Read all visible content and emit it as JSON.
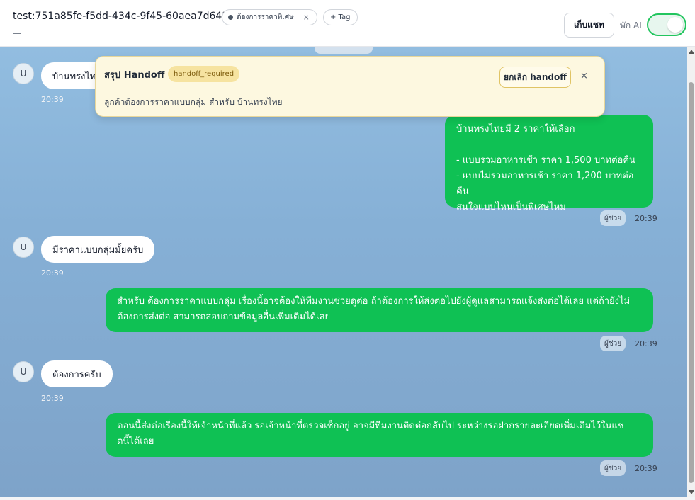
{
  "header": {
    "conversation_id": "test:751a85fe-f5dd-434c-9f45-60aea7d6432a",
    "subtitle": "—",
    "tag_label": "ต้องการราคาพิเศษ",
    "tag_remove": "×",
    "add_tag_label": "+ Tag",
    "keep_chat_label": "เก็บแชท",
    "ai_pause_label": "พัก AI",
    "ai_toggle_on": true
  },
  "handoff": {
    "title": "สรุป Handoff",
    "status_badge": "handoff_required",
    "cancel_label": "ยกเลิก handoff",
    "close_label": "×",
    "summary": "ลูกค้าต้องการราคาแบบกลุ่ม สำหรับ บ้านทรงไทย"
  },
  "messages": [
    {
      "role": "user",
      "avatar": "U",
      "text": "บ้านทรงไทย",
      "time": "20:39"
    },
    {
      "role": "assistant",
      "lines": [
        "บ้านทรงไทยมี 2 ราคาให้เลือก",
        "",
        "- แบบรวมอาหารเช้า ราคา 1,500 บาทต่อคืน",
        "- แบบไม่รวมอาหารเช้า ราคา 1,200 บาทต่อคืน",
        "สนใจแบบไหนเป็นพิเศษไหม"
      ],
      "badge": "ผู้ช่วย",
      "time": "20:39"
    },
    {
      "role": "user",
      "avatar": "U",
      "text": "มีราคาแบบกลุ่มมั้ยครับ",
      "time": "20:39"
    },
    {
      "role": "assistant",
      "lines": [
        "สำหรับ ต้องการราคาแบบกลุ่ม เรื่องนี้อาจต้องให้ทีมงานช่วยดูต่อ ถ้าต้องการให้ส่งต่อไปยังผู้ดูแลสามารถแจ้งส่งต่อได้เลย แต่ถ้ายังไม่",
        "ต้องการส่งต่อ สามารถสอบถามข้อมูลอื่นเพิ่มเติมได้เลย"
      ],
      "badge": "ผู้ช่วย",
      "time": "20:39"
    },
    {
      "role": "user",
      "avatar": "U",
      "text": "ต้องการครับ",
      "time": "20:39"
    },
    {
      "role": "assistant",
      "lines": [
        "ตอนนี้ส่งต่อเรื่องนี้ให้เจ้าหน้าที่แล้ว รอเจ้าหน้าที่ตรวจเช็กอยู่ อาจมีทีมงานติดต่อกลับไป ระหว่างรอฝากรายละเอียดเพิ่มเติมไว้ในแช",
        "ตนี้ได้เลย"
      ],
      "badge": "ผู้ช่วย",
      "time": "20:39"
    }
  ],
  "colors": {
    "assistant_bubble": "#0fc154",
    "user_bubble": "#ffffff",
    "handoff_bg": "#fdf8e0",
    "toggle_on": "#22c55e"
  }
}
